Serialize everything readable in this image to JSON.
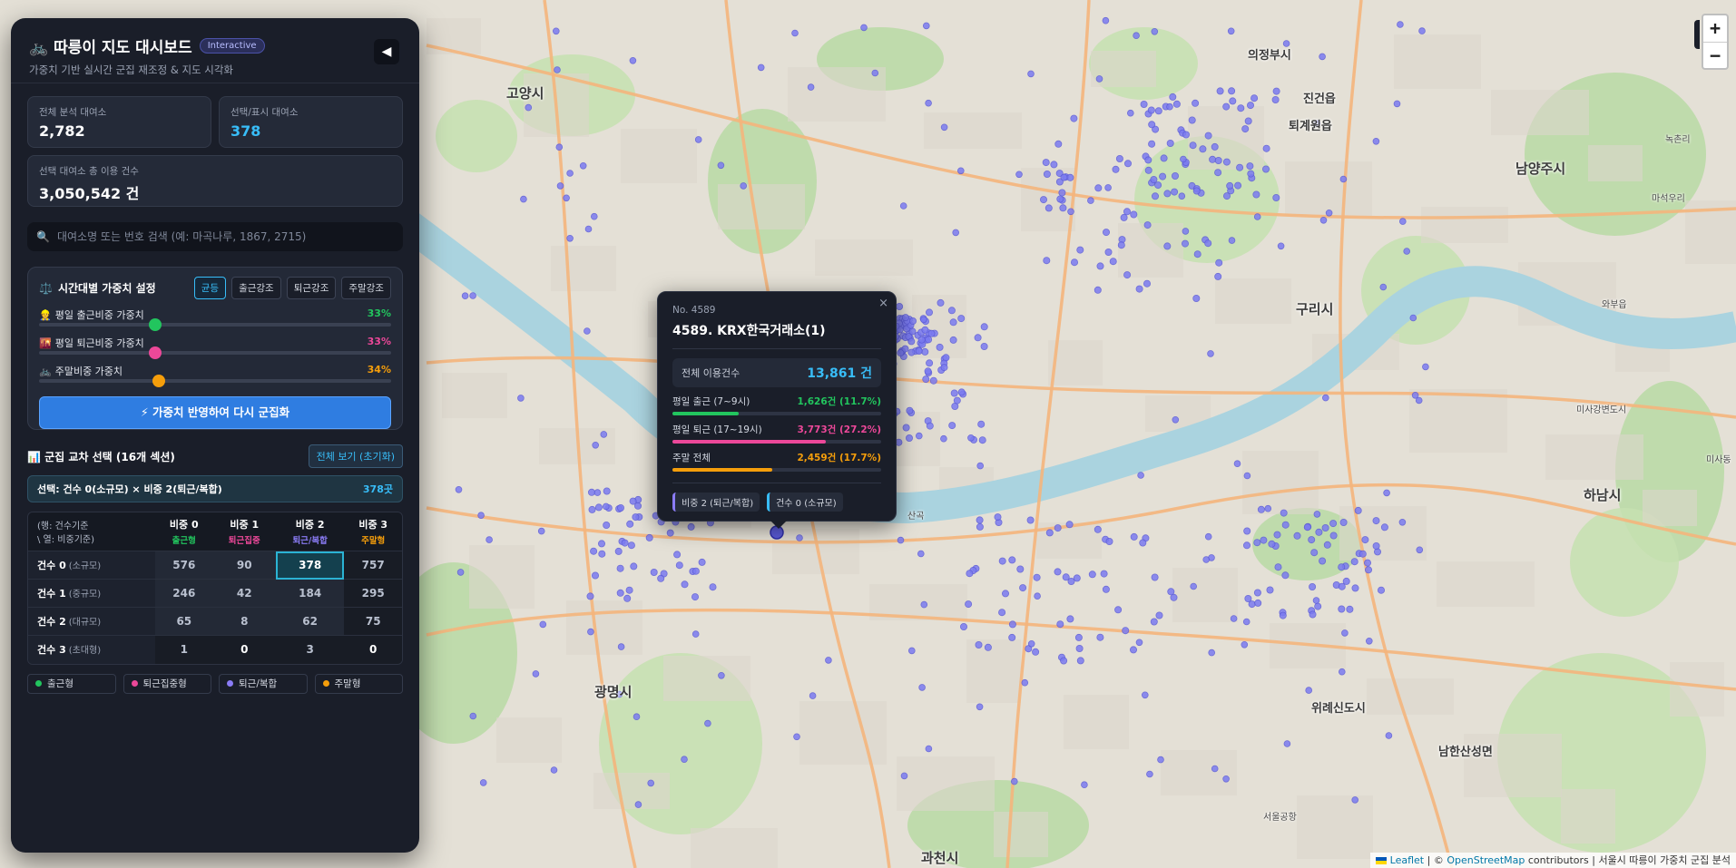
{
  "colors": {
    "commute_in": "#22c55e",
    "commute_out": "#ec4899",
    "mixed": "#8b7cf6",
    "weekend": "#f59e0b",
    "accent": "#38bdf8"
  },
  "header": {
    "icon": "bicycle-icon",
    "title": "🚲 따릉이 지도 대시보드",
    "badge": "Interactive",
    "subtitle": "가중치 기반 실시간 군집 재조정 & 지도 시각화",
    "collapse": "◀"
  },
  "stats": {
    "total_label": "전체 분석 대여소",
    "total_value": "2,782",
    "selected_label": "선택/표시 대여소",
    "selected_value": "378",
    "usage_label": "선택 대여소 총 이용 건수",
    "usage_value": "3,050,542 건"
  },
  "search": {
    "placeholder": "대여소명 또는 번호 검색 (예: 마곡나루, 1867, 2715)",
    "icon": "🔍"
  },
  "weights": {
    "title": "시간대별 가중치 설정",
    "icon": "⚖️",
    "presets": [
      "균등",
      "출근강조",
      "퇴근강조",
      "주말강조"
    ],
    "sliders": [
      {
        "icon": "👷",
        "label": "평일 출근비중 가중치",
        "pct": "33%",
        "value": 0.33,
        "color": "#22c55e"
      },
      {
        "icon": "🌇",
        "label": "평일 퇴근비중 가중치",
        "pct": "33%",
        "value": 0.33,
        "color": "#ec4899"
      },
      {
        "icon": "🚲",
        "label": "주말비중 가중치",
        "pct": "34%",
        "value": 0.34,
        "color": "#f59e0b"
      }
    ],
    "apply": "⚡ 가중치 반영하여 다시 군집화"
  },
  "cluster": {
    "title": "📊 군집 교차 선택 (16개 섹션)",
    "reset": "전체 보기 (초기화)",
    "selection_text": "선택: 건수 0(소규모) × 비중 2(퇴근/복합)",
    "selection_count": "378곳",
    "corner": [
      "(행: 건수기준",
      "\\ 열: 비중기준)"
    ],
    "columns": [
      {
        "name": "비중 0",
        "sub": "출근형",
        "color": "#22c55e"
      },
      {
        "name": "비중 1",
        "sub": "퇴근집중",
        "color": "#ec4899"
      },
      {
        "name": "비중 2",
        "sub": "퇴근/복합",
        "color": "#8b7cf6"
      },
      {
        "name": "비중 3",
        "sub": "주말형",
        "color": "#f59e0b"
      }
    ],
    "rows": [
      {
        "name": "건수 0",
        "sub": "(소규모)",
        "values": [
          "576",
          "90",
          "378",
          "757"
        ]
      },
      {
        "name": "건수 1",
        "sub": "(중규모)",
        "values": [
          "246",
          "42",
          "184",
          "295"
        ]
      },
      {
        "name": "건수 2",
        "sub": "(대규모)",
        "values": [
          "65",
          "8",
          "62",
          "75"
        ]
      },
      {
        "name": "건수 3",
        "sub": "(초대형)",
        "values": [
          "1",
          "0",
          "3",
          "0"
        ]
      }
    ]
  },
  "legend": [
    {
      "label": "출근형",
      "color": "#22c55e"
    },
    {
      "label": "퇴근집중형",
      "color": "#ec4899"
    },
    {
      "label": "퇴근/복합",
      "color": "#8b7cf6"
    },
    {
      "label": "주말형",
      "color": "#f59e0b"
    }
  ],
  "popup": {
    "no": "No. 4589",
    "name": "4589. KRX한국거래소(1)",
    "total_label": "전체 이용건수",
    "total_value": "13,861 건",
    "close": "×",
    "bars": [
      {
        "label": "평일 출근 (7~9시)",
        "value": "1,626건 (11.7%)",
        "ratio": 0.317,
        "color": "#22c55e"
      },
      {
        "label": "평일 퇴근 (17~19시)",
        "value": "3,773건 (27.2%)",
        "ratio": 0.735,
        "color": "#ec4899"
      },
      {
        "label": "주말 전체",
        "value": "2,459건 (17.7%)",
        "ratio": 0.479,
        "color": "#f59e0b"
      }
    ],
    "tags": [
      "비중 2 (퇴근/복합)",
      "건수 0 (소규모)"
    ]
  },
  "map": {
    "zoom_in": "+",
    "zoom_out": "−",
    "attribution_leaflet": "Leaflet",
    "attribution_osm": "OpenStreetMap",
    "attribution_rest": "contributors | 서울시 따릉이 가중치 군집 분석",
    "attribution_sep": "| ©",
    "labels": [
      "고양시",
      "의정부시",
      "남양주시",
      "구리시",
      "하남시",
      "광명시",
      "과천시",
      "진건읍",
      "퇴계원읍",
      "와부읍",
      "미사강변도시",
      "위례신도시",
      "남한산성면",
      "서울공항",
      "산곡",
      "미사동",
      "녹촌리",
      "마석우리"
    ]
  }
}
